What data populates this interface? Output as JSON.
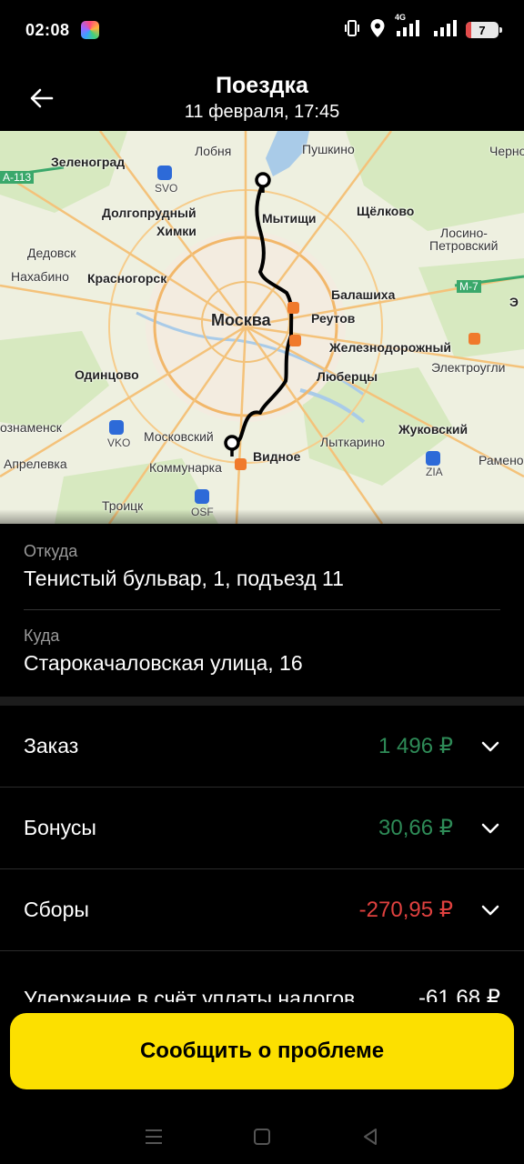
{
  "status": {
    "time": "02:08",
    "network": "4G",
    "battery": "7"
  },
  "header": {
    "title": "Поездка",
    "subtitle": "11 февраля, 17:45"
  },
  "map": {
    "labels": {
      "zelenograd": "Зеленоград",
      "lobnya": "Лобня",
      "pushkino": "Пушкино",
      "chernogolovka": "Черно",
      "a113": "A-113",
      "svo": "SVO",
      "dolgoprudny": "Долгопрудный",
      "mytishchi": "Мытищи",
      "shchelkovo": "Щёлково",
      "khimki": "Химки",
      "losino1": "Лосино-",
      "losino2": "Петровский",
      "dedovsk": "Дедовск",
      "nakhabino": "Нахабино",
      "krasnogorsk": "Красногорск",
      "balashikha": "Балашиха",
      "m7": "М-7",
      "moskva": "Москва",
      "reutov": "Реутов",
      "zheleznodorozhny": "Железнодорожный",
      "odintsovo": "Одинцово",
      "lyubertsy": "Люберцы",
      "elektrougli": "Электроугли",
      "znamensk": "ознаменск",
      "vko": "VKO",
      "moskovsky": "Московский",
      "zhukovsky": "Жуковский",
      "lytkarino": "Лыткарино",
      "aprelevka": "Апрелевка",
      "kommunarka": "Коммунарка",
      "vidnoe": "Видное",
      "zia": "ZIA",
      "ramenskoe": "Рамено",
      "troitsk": "Троицк",
      "osf": "OSF",
      "e": "Э"
    }
  },
  "route": {
    "from_label": "Откуда",
    "from_value": "Тенистый бульвар, 1, подъезд 11",
    "to_label": "Куда",
    "to_value": "Старокачаловская улица, 16"
  },
  "finance": {
    "rows": [
      {
        "label": "Заказ",
        "amount": "1 496 ₽"
      },
      {
        "label": "Бонусы",
        "amount": "30,66 ₽"
      },
      {
        "label": "Сборы",
        "amount": "-270,95 ₽"
      },
      {
        "label": "Удержание в счёт уплаты налогов",
        "amount": "-61,68 ₽"
      }
    ],
    "colors": {
      "positive": "#2e8b57",
      "negative": "#e0413f"
    }
  },
  "actions": {
    "report_label": "Сообщить о проблеме",
    "accent": "#fce000"
  },
  "nav": {
    "icons": [
      "menu-icon",
      "home-icon",
      "back-icon"
    ]
  }
}
